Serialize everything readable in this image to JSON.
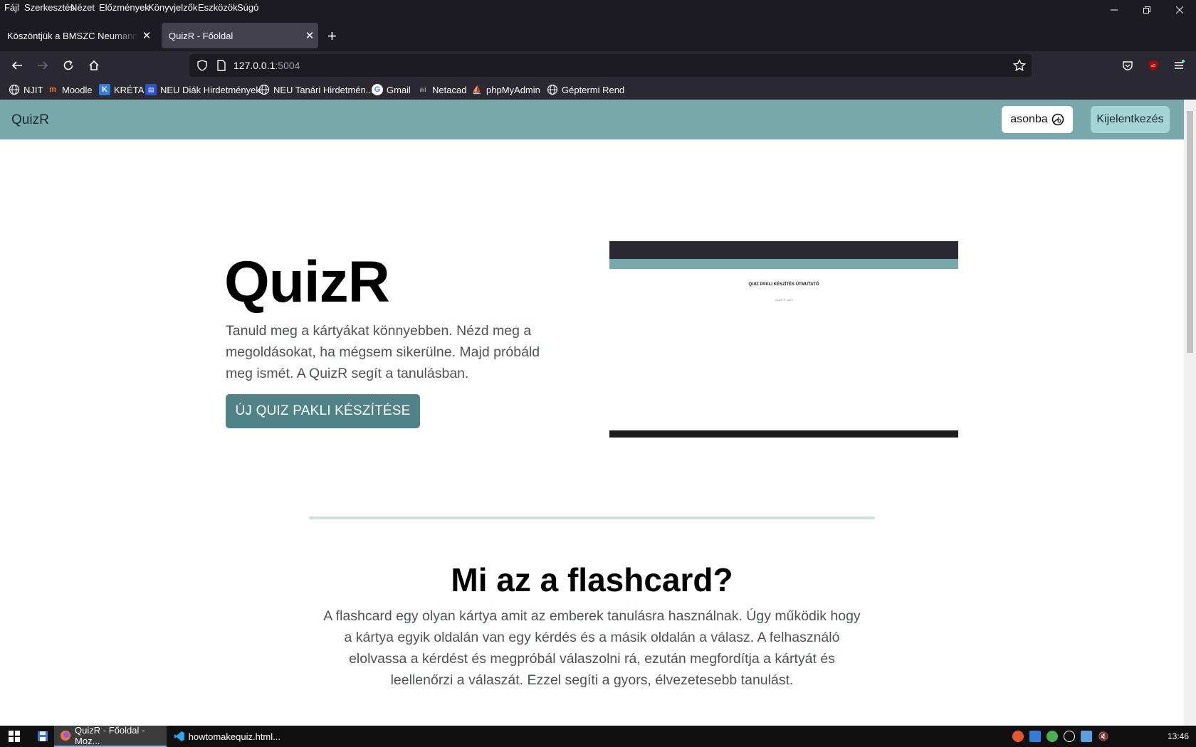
{
  "menubar": {
    "items": [
      "Fájl",
      "Szerkesztés",
      "Nézet",
      "Előzmények",
      "Könyvjelzők",
      "Eszközök",
      "Súgó"
    ]
  },
  "tabs": [
    {
      "title": "Köszöntjük a BMSZC Neumann János",
      "active": false
    },
    {
      "title": "QuizR - Főoldal",
      "active": true
    }
  ],
  "urlbar": {
    "host": "127.0.0.1",
    "port": ":5004"
  },
  "bookmarks": [
    {
      "label": "NJIT",
      "icon": "globe-icon"
    },
    {
      "label": "Moodle",
      "icon": "moodle-icon"
    },
    {
      "label": "KRÉTA",
      "icon": "kreta-icon"
    },
    {
      "label": "NEU Diák Hirdetmények",
      "icon": "news-icon"
    },
    {
      "label": "NEU Tanári Hirdetmén...",
      "icon": "globe-icon"
    },
    {
      "label": "Gmail",
      "icon": "google-icon"
    },
    {
      "label": "Netacad",
      "icon": "cisco-icon"
    },
    {
      "label": "phpMyAdmin",
      "icon": "phpmyadmin-icon"
    },
    {
      "label": "Géptermi Rend",
      "icon": "globe-icon"
    }
  ],
  "site": {
    "brand": "QuizR",
    "user_label": "asonba",
    "logout_label": "Kijelentkezés",
    "hero_title": "QuizR",
    "hero_text": "Tanuld meg a kártyákat könnyebben. Nézd meg a megoldásokat, ha mégsem sikerülne. Majd próbáld meg ismét. A QuizR segít a tanulásban.",
    "cta_label": "ÚJ QUIZ PAKLI KÉSZÍTÉSE",
    "preview_title": "QUIZ PAKLI KÉSZÍTÉS ÚTMUTATÓ",
    "preview_footer": "QuizR © 2023",
    "section_title": "Mi az a flashcard?",
    "section_text": "A flashcard egy olyan kártya amit az emberek tanulásra használnak. Úgy működik hogy a kártya egyik oldalán van egy kérdés és a másik oldalán a válasz. A felhasználó elolvassa a kérdést és megpróbál válaszolni rá, ezután megfordítja a kártyát és leellenőrzi a válaszát. Ezzel segíti a gyors, élvezetesebb tanulást."
  },
  "taskbar": {
    "items": [
      {
        "label": "QuizR - Főoldal - Moz...",
        "icon": "firefox-icon"
      },
      {
        "label": "howtomakequiz.html...",
        "icon": "vscode-icon"
      }
    ],
    "clock": "13:46"
  },
  "colors": {
    "navbar": "#77a8ab",
    "cta": "#4f8387",
    "logout": "#a3d4d7"
  }
}
